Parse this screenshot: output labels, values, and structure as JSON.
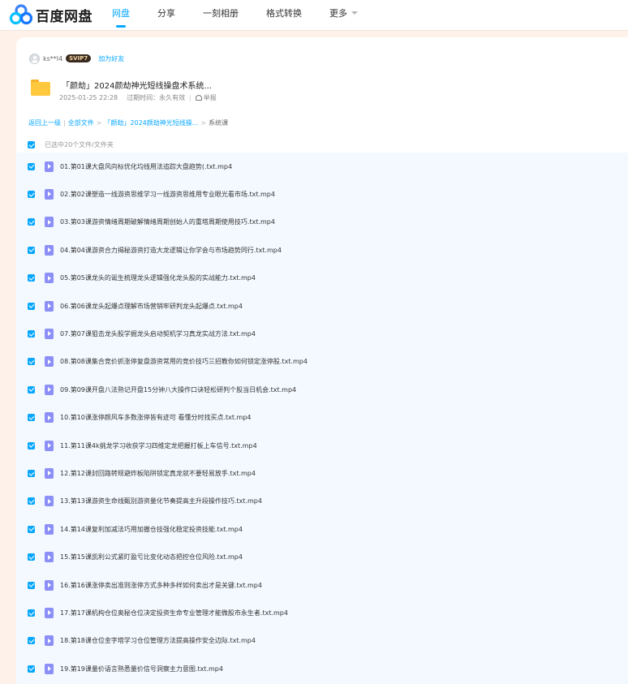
{
  "app": {
    "name": "百度网盘",
    "nav": [
      {
        "label": "网盘",
        "active": true
      },
      {
        "label": "分享",
        "active": false
      },
      {
        "label": "一刻相册",
        "active": false
      },
      {
        "label": "格式转换",
        "active": false
      },
      {
        "label": "更多",
        "active": false
      }
    ]
  },
  "share": {
    "user": "ks**l4",
    "badge": "SVIP7",
    "add_friend": "加为好友",
    "title": "「颜劫」2024颜劫神光短线操盘术系统...",
    "date": "2025-01-25 22:28",
    "expire": "过期时间：永久有效",
    "report": "举报"
  },
  "breadcrumb": {
    "back": "返回上一级",
    "all": "全部文件",
    "folder": "「颜劫」2024颜劫神光短线操...",
    "current": "系统课"
  },
  "selection": {
    "text": "已选中20个文件/文件夹"
  },
  "files": [
    "01.第01课大盘风向标优化均线用法追踪大盘趋势(.txt.mp4",
    "02.第02课塑造一线游资思维学习一线游资思维用专业眼光看市场.txt.mp4",
    "03.第03课游资情绪周期破解情绪周期创始人的重塔周期使用技巧.txt.mp4",
    "04.第04课游资合力揭秘游资打造大龙逻辑让你学会与市场趋势同行.txt.mp4",
    "05.第05课龙头的诞生梳理龙头逻辑强化龙头股的实战能力.txt.mp4",
    "06.第06课龙头起爆点理解市场营销牢研判龙头起爆点.txt.mp4",
    "07.第07课狙击龙头股学掘龙头启动契机学习真龙实战方法.txt.mp4",
    "08.第08课集合竞价抓涨停复盘游资常用的竞价技巧三招教你如何锁定涨停股.txt.mp4",
    "09.第09课开盘八法熟记开盘15分钟八大操作口诀轻松研判个股当日机会.txt.mp4",
    "10.第10课涨停颜风车多数涨停皆有迹可 看懂分时找买点.txt.mp4",
    "11.第11课4k挑龙学习收获学习四维定龙把握打板上车信号.txt.mp4",
    "12.第12课封回路转规避炸板陷阱锁定真龙就不要轻易放手.txt.mp4",
    "13.第13课游资生命线甄别游资量化节奏提高主升段操作技巧.txt.mp4",
    "14.第14课复利加减法巧用加撤仓技强化稳定投资技能.txt.mp4",
    "15.第15课凯利公式紧盯盈亏比变化动态把控仓位风险.txt.mp4",
    "16.第16课涨停卖出准则涨停方式多种多样如何卖出才是关键.txt.mp4",
    "17.第17课机构仓位奥秘仓位决定投资生命专业管理才能微股市永生者.txt.mp4",
    "18.第18课仓位金字塔学习仓位管理方法提高操作安全边际.txt.mp4",
    "19.第19课量价语言熟悉量价信号洞察主力意图.txt.mp4"
  ],
  "colors": {
    "accent": "#06a7ff",
    "video_icon": "#8c8ff5",
    "folder": "#ffc83d"
  }
}
